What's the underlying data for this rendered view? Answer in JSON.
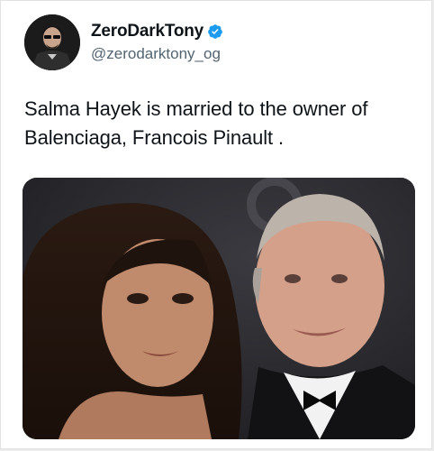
{
  "tweet": {
    "display_name": "ZeroDarkTony",
    "handle": "@zerodarktony_og",
    "verified_icon": "verified-badge-icon",
    "text": "Salma Hayek is married to the owner of Balenciaga, Francois Pinault ."
  },
  "colors": {
    "verified": "#1d9bf0",
    "name": "#0f1419",
    "handle": "#536471"
  }
}
